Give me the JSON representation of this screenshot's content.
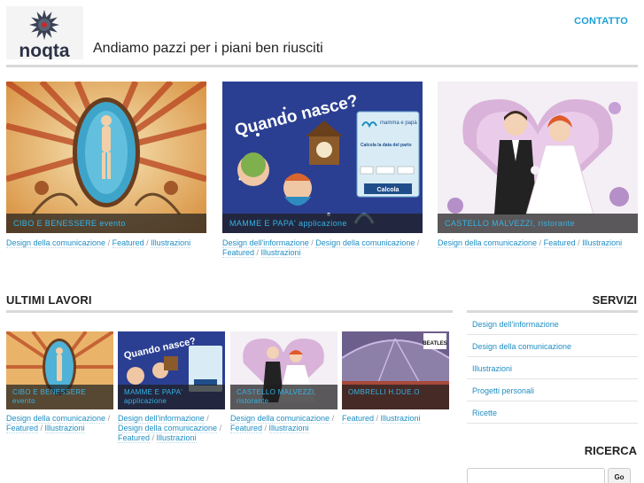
{
  "header": {
    "logo_text": "noqta",
    "tagline": "Andiamo pazzi per i piani ben riusciti",
    "contact_label": "CONTATTO"
  },
  "featured": [
    {
      "caption": "CIBO E BENESSERE evento",
      "tags": [
        "Design della comunicazione",
        "Featured",
        "Illustrazioni"
      ]
    },
    {
      "caption": "MAMME E PAPA' applicazione",
      "tags": [
        "Design dell'informazione",
        "Design della comunicazione",
        "Featured",
        "Illustrazioni"
      ],
      "image_text": {
        "title": "Quando nasce?",
        "brand": "mamma e papà",
        "prompt": "Calcola la data del parto",
        "button": "Calcola"
      }
    },
    {
      "caption": "CASTELLO MALVEZZI, ristorante",
      "tags": [
        "Design della comunicazione",
        "Featured",
        "Illustrazioni"
      ]
    }
  ],
  "recent_section": {
    "title": "ULTIMI LAVORI"
  },
  "recent": [
    {
      "caption": "CIBO E BENESSERE evento",
      "tags": [
        "Design della comunicazione",
        "Featured",
        "Illustrazioni"
      ]
    },
    {
      "caption": "MAMME E PAPA' applicazione",
      "tags": [
        "Design dell'informazione",
        "Design della comunicazione",
        "Featured",
        "Illustrazioni"
      ]
    },
    {
      "caption": "CASTELLO MALVEZZI, ristorante",
      "tags": [
        "Design della comunicazione",
        "Featured",
        "Illustrazioni"
      ]
    },
    {
      "caption": "OMBRELLI H.DUE.O",
      "tags": [
        "Featured",
        "Illustrazioni"
      ],
      "badge": "BEATLES"
    }
  ],
  "sidebar": {
    "servizi_title": "SERVIZI",
    "servizi": [
      "Design dell'informazione",
      "Design della comunicazione",
      "Illustrazioni",
      "Progetti personali",
      "Ricette"
    ],
    "ricerca_title": "RICERCA",
    "search_button": "Go",
    "search_value": ""
  },
  "colors": {
    "accent": "#1ba0d6",
    "link": "#1f8ec3",
    "rule": "#d9d9d9"
  }
}
